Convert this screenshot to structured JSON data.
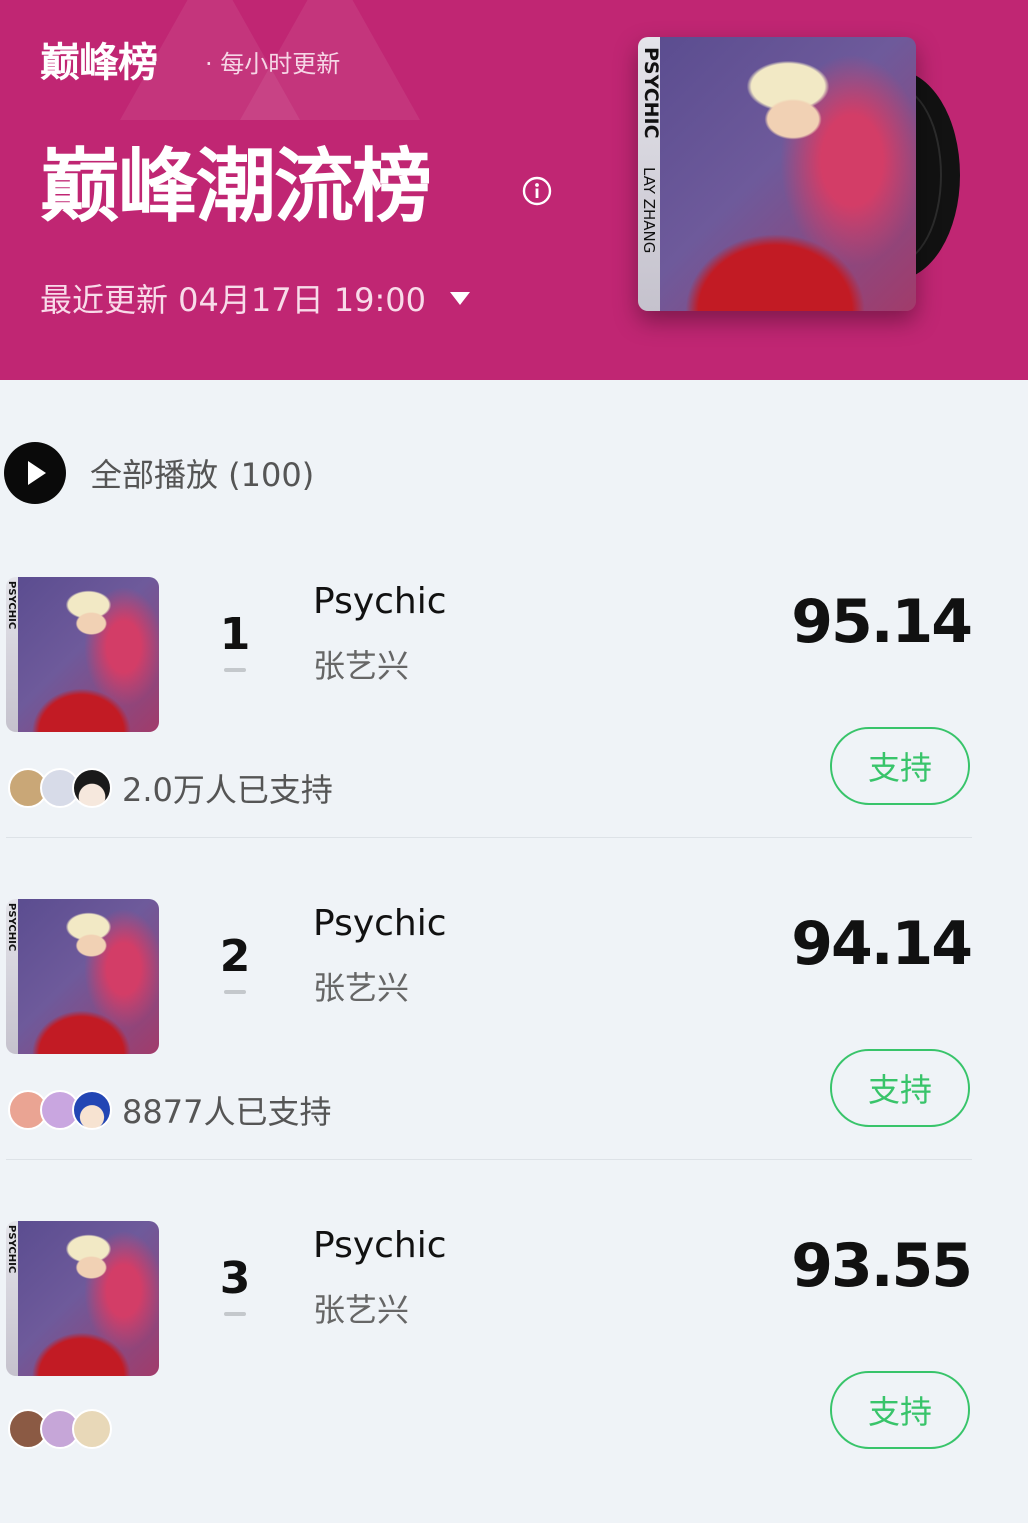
{
  "header": {
    "brand": "巅峰榜",
    "brand_sub": "· 每小时更新",
    "chart_title": "巅峰潮流榜",
    "update_label": "最近更新 04月17日 19:00",
    "cover_text": "PSYCHIC",
    "cover_sub": "LAY ZHANG"
  },
  "play_all": {
    "label": "全部播放 (100)"
  },
  "items": [
    {
      "rank": "1",
      "song": "Psychic",
      "artist": "张艺兴",
      "score": "95.14",
      "supporters": "2.0万人已支持",
      "button": "支持",
      "cover_text": "PSYCHIC"
    },
    {
      "rank": "2",
      "song": "Psychic",
      "artist": "张艺兴",
      "score": "94.14",
      "supporters": "8877人已支持",
      "button": "支持",
      "cover_text": "PSYCHIC"
    },
    {
      "rank": "3",
      "song": "Psychic",
      "artist": "张艺兴",
      "score": "93.55",
      "supporters": "",
      "button": "支持",
      "cover_text": "PSYCHIC"
    }
  ],
  "colors": {
    "header_bg": "#c02673",
    "accent_green": "#38c46a",
    "page_bg": "#eff3f7"
  }
}
